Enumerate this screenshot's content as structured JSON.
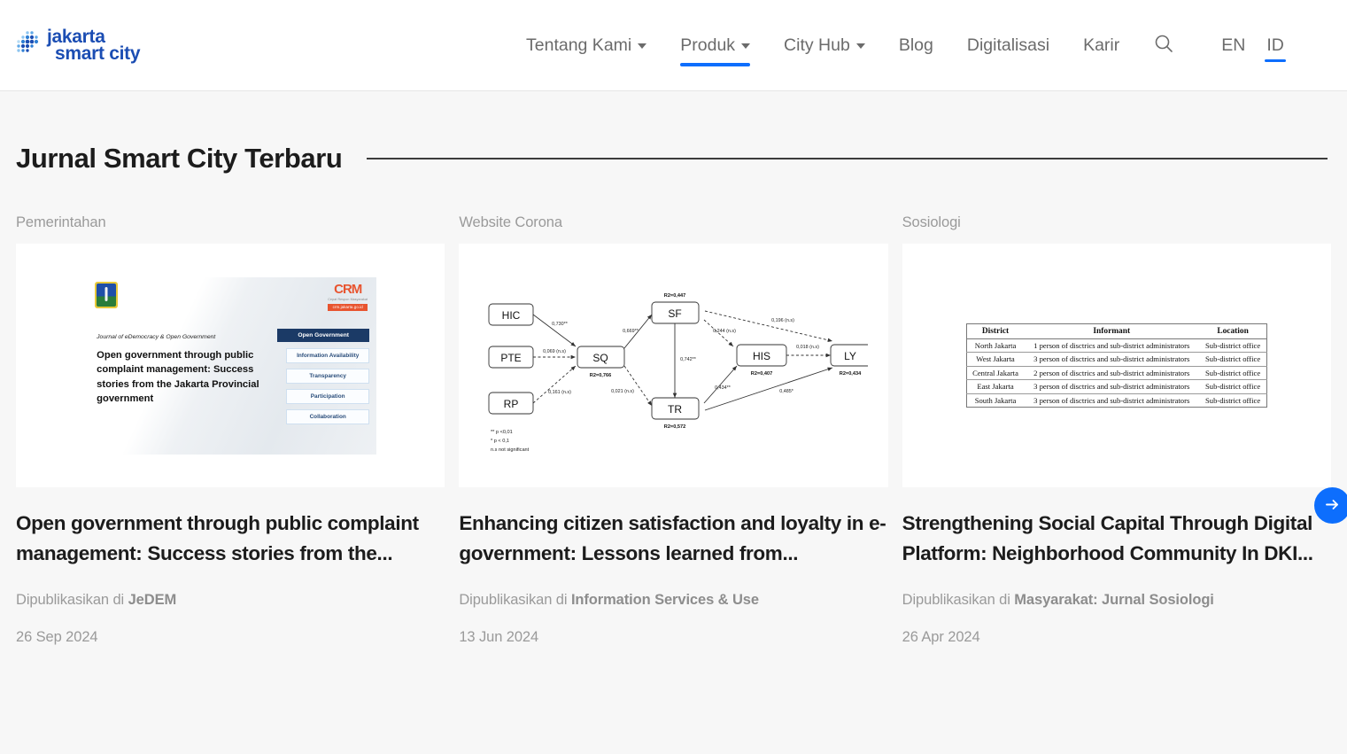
{
  "brand": {
    "logo_line1": "jakarta",
    "logo_line2": "smart city",
    "accent_color": "#0d6efd",
    "logo_color": "#1b4db3"
  },
  "nav": {
    "items": [
      {
        "label": "Tentang Kami",
        "has_dropdown": true,
        "active": false
      },
      {
        "label": "Produk",
        "has_dropdown": true,
        "active": true
      },
      {
        "label": "City Hub",
        "has_dropdown": true,
        "active": false
      },
      {
        "label": "Blog",
        "has_dropdown": false,
        "active": false
      },
      {
        "label": "Digitalisasi",
        "has_dropdown": false,
        "active": false
      },
      {
        "label": "Karir",
        "has_dropdown": false,
        "active": false
      }
    ],
    "search_icon": "search-icon",
    "languages": [
      {
        "label": "EN",
        "active": false
      },
      {
        "label": "ID",
        "active": true
      }
    ]
  },
  "section": {
    "title": "Jurnal Smart City Terbaru",
    "next_button_icon": "arrow-right-icon"
  },
  "cards": [
    {
      "category": "Pemerintahan",
      "title": "Open government through public complaint management: Success stories from the...",
      "published_prefix": "Dipublikasikan di",
      "publisher": "JeDEM",
      "date": "26 Sep 2024",
      "thumbnail": {
        "kind": "journal-cover",
        "journal_line": "Journal of eDemocracy & Open Government",
        "cover_title": "Open government through public complaint management: Success stories from the Jakarta Provincial government",
        "emblem": "dki-jakarta-emblem",
        "crm_logo": "CRM",
        "crm_tagline": "Cepat Respon Masyarakat",
        "crm_url": "crm.jakarta.go.id",
        "flow_head": "Open Government",
        "flow_items": [
          "Information Availability",
          "Transparency",
          "Participation",
          "Collaboration"
        ]
      }
    },
    {
      "category": "Website Corona",
      "title": "Enhancing citizen satisfaction and loyalty in e-government: Lessons learned from...",
      "published_prefix": "Dipublikasikan di",
      "publisher": "Information Services & Use",
      "date": "13 Jun 2024",
      "thumbnail": {
        "kind": "path-diagram",
        "nodes": [
          {
            "id": "HIC",
            "label": "HIC",
            "r2": ""
          },
          {
            "id": "PTE",
            "label": "PTE",
            "r2": ""
          },
          {
            "id": "RP",
            "label": "RP",
            "r2": ""
          },
          {
            "id": "SQ",
            "label": "SQ",
            "r2": "R2=0,766"
          },
          {
            "id": "SF",
            "label": "SF",
            "r2": "R2=0,447"
          },
          {
            "id": "TR",
            "label": "TR",
            "r2": "R2=0,572"
          },
          {
            "id": "HIS",
            "label": "HIS",
            "r2": "R2=0,407"
          },
          {
            "id": "LY",
            "label": "LY",
            "r2": "R2=0,434"
          }
        ],
        "edges": [
          {
            "from": "HIC",
            "to": "SQ",
            "label": "0,730**",
            "style": "solid"
          },
          {
            "from": "PTE",
            "to": "SQ",
            "label": "0,069 (n.s)",
            "style": "dashed"
          },
          {
            "from": "RP",
            "to": "SQ",
            "label": "0,161 (n.s)",
            "style": "dashed"
          },
          {
            "from": "SQ",
            "to": "SF",
            "label": "0,669**",
            "style": "solid"
          },
          {
            "from": "SQ",
            "to": "TR",
            "label": "0,021 (n.s)",
            "style": "dashed"
          },
          {
            "from": "SF",
            "to": "TR",
            "label": "0,742**",
            "style": "solid"
          },
          {
            "from": "SF",
            "to": "HIS",
            "label": "0,244 (n.s)",
            "style": "dashed"
          },
          {
            "from": "SF",
            "to": "LY",
            "label": "0,196 (n.s)",
            "style": "dashed"
          },
          {
            "from": "HIS",
            "to": "LY",
            "label": "0,018 (n.s)",
            "style": "dashed"
          },
          {
            "from": "TR",
            "to": "HIS",
            "label": "0,434**",
            "style": "solid"
          },
          {
            "from": "TR",
            "to": "LY",
            "label": "0,485*",
            "style": "solid"
          }
        ],
        "legend": [
          "**   p <0,01",
          "*    p < 0,1",
          "n.s not significant"
        ]
      }
    },
    {
      "category": "Sosiologi",
      "title": "Strengthening Social Capital Through Digital Platform: Neighborhood Community In DKI...",
      "published_prefix": "Dipublikasikan di",
      "publisher": "Masyarakat: Jurnal Sosiologi",
      "date": "26 Apr 2024",
      "thumbnail": {
        "kind": "table",
        "columns": [
          "District",
          "Informant",
          "Location"
        ],
        "rows": [
          [
            "North Jakarta",
            "1 person of disctrics and sub-district administrators",
            "Sub-district office"
          ],
          [
            "West Jakarta",
            "3 person of disctrics and sub-district administrators",
            "Sub-district office"
          ],
          [
            "Central Jakarta",
            "2 person of disctrics and sub-district administrators",
            "Sub-district office"
          ],
          [
            "East Jakarta",
            "3 person of disctrics and sub-district administrators",
            "Sub-district office"
          ],
          [
            "South Jakarta",
            "3 person of disctrics and sub-district administrators",
            "Sub-district office"
          ]
        ]
      }
    }
  ]
}
